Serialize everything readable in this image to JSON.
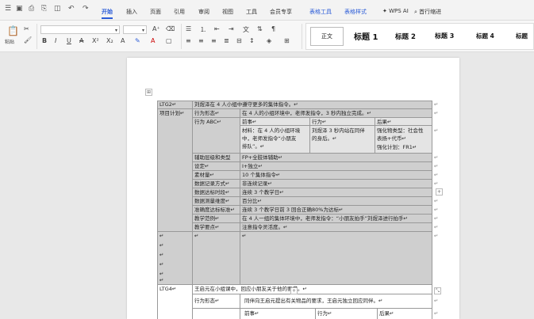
{
  "menu": {
    "tabs": [
      "开始",
      "插入",
      "页面",
      "引用",
      "审阅",
      "视图",
      "工具",
      "会员专享"
    ],
    "context_tabs": [
      "表格工具",
      "表格样式"
    ],
    "wps_ai": "WPS AI",
    "search": "首行缩进"
  },
  "ribbon": {
    "paste": "粘贴",
    "styles": [
      "正文",
      "标题 1",
      "标题 2",
      "标题 3",
      "标题 4",
      "标题"
    ]
  },
  "doc": {
    "r0_c0": "LTG2↵",
    "r0_c1": "刘煜泽在 4 人小组中遵守更多的集体指令。↵",
    "r1_c0": "项目计划↵",
    "r1_c1": "行为形态↵",
    "r1_c2": "在 4 人的小组环境中，老师发指令，3 秒内独立完成。↵",
    "r2_c1": "行为 ABC↵",
    "r2_h1": "前事↵",
    "r2_h2": "行为↵",
    "r2_h3": "后果↵",
    "r2_a1": "材料：在 4 人的小组环境",
    "r2_a2": "中，老师发指令“小朋友",
    "r2_a3": "排队”。↵",
    "r2_b1": "刘煜泽 3 秒内站在同伴",
    "r2_b2": "的身后。↵",
    "r2_c1t": "强化物类型：社会性",
    "r2_c2t": "表扬+代币↵",
    "r2_c3t": "强化计划：FR1↵",
    "rows": [
      {
        "k": "辅助层级和类型",
        "v": "FP+全肢体辅助↵"
      },
      {
        "k": "设定↵",
        "v": "I+独立↵"
      },
      {
        "k": "素材量↵",
        "v": "10 个集体指令↵"
      },
      {
        "k": "数据记录方式↵",
        "v": "非连续记录↵"
      },
      {
        "k": "数据达标时段↵",
        "v": "连续 3 个教学日↵"
      },
      {
        "k": "数据测量维度↵",
        "v": "百分比↵"
      },
      {
        "k": "准确度达标标准↵",
        "v": "连续 3 个教学日前 3 回合正确80%为达标↵"
      },
      {
        "k": "教学范例↵",
        "v": "在 4 人一组的集体环境中，老师发指令：“小朋友拍手”刘煜泽进行拍手↵"
      },
      {
        "k": "教学要点↵",
        "v": "注意指令灵活度。↵"
      }
    ],
    "ltg4": "LTG4↵",
    "ltg4_goal": "王启元在小组课中，回应小朋友关于他的要求。↵",
    "ltg4_form_k": "行为形态↵",
    "ltg4_form_v": "同伴向王启元提出有关物品的要求，王启元独立回应同伴。↵",
    "ltg4_h1": "前事↵",
    "ltg4_h2": "行为↵",
    "ltg4_h3": "后果↵",
    "para_mark": "↵"
  }
}
